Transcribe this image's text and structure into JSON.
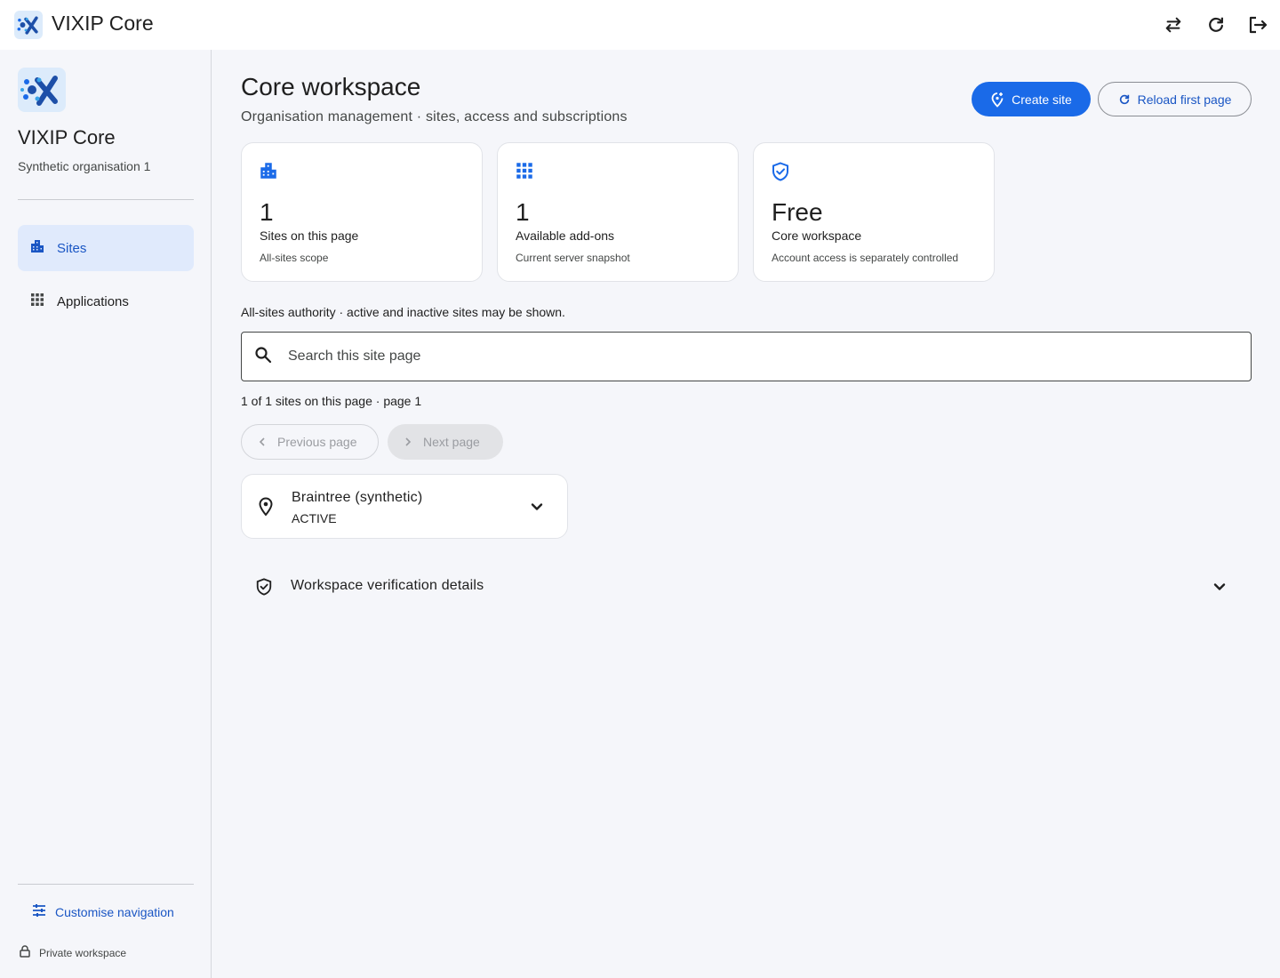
{
  "app": {
    "title": "VIXIP Core"
  },
  "topbar": {
    "icons": [
      "swap-icon",
      "refresh-icon",
      "logout-icon"
    ]
  },
  "sidebar": {
    "org_title": "VIXIP Core",
    "org_subtitle": "Synthetic organisation 1",
    "items": [
      {
        "label": "Sites",
        "icon": "business-icon",
        "active": true
      },
      {
        "label": "Applications",
        "icon": "apps-grid-icon",
        "active": false
      }
    ],
    "customise_label": "Customise navigation",
    "private_label": "Private workspace"
  },
  "main": {
    "title": "Core workspace",
    "subtitle": "Organisation management · sites, access and subscriptions",
    "create_label": "Create site",
    "reload_label": "Reload first page",
    "stats": [
      {
        "icon": "business-icon",
        "value": "1",
        "label": "Sites on this page",
        "note": "All-sites scope"
      },
      {
        "icon": "apps-grid-icon",
        "value": "1",
        "label": "Available add-ons",
        "note": "Current server snapshot"
      },
      {
        "icon": "verified-shield-icon",
        "value": "Free",
        "label": "Core workspace",
        "note": "Account access is separately controlled"
      }
    ],
    "authority_text": "All-sites authority · active and inactive sites may be shown.",
    "search_placeholder": "Search this site page",
    "count_text": "1 of 1 sites on this page · page 1",
    "prev_label": "Previous page",
    "next_label": "Next page",
    "sites": [
      {
        "name": "Braintree (synthetic)",
        "status": "ACTIVE"
      }
    ],
    "verification_label": "Workspace verification details"
  },
  "colors": {
    "accent": "#1a6ae8",
    "link": "#1a56c4",
    "active_nav": "#e0eafc",
    "background": "#f5f6fa"
  }
}
